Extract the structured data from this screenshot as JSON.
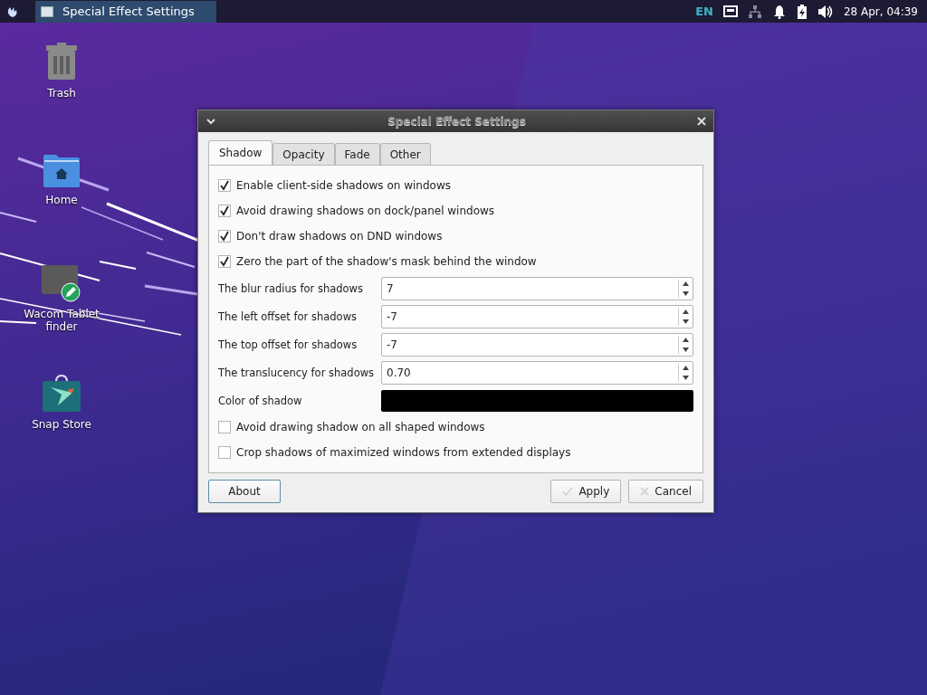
{
  "taskbar": {
    "window_button": "Special Effect Settings",
    "language": "EN",
    "clock": "28 Apr, 04:39"
  },
  "desktop_icons": [
    {
      "label": "Trash",
      "kind": "trash"
    },
    {
      "label": "Home",
      "kind": "home"
    },
    {
      "label": "Wacom Tablet finder",
      "kind": "wacom"
    },
    {
      "label": "Snap Store",
      "kind": "store"
    }
  ],
  "dialog": {
    "title": "Special Effect Settings",
    "tabs": [
      {
        "label": "Shadow",
        "selected": true
      },
      {
        "label": "Opacity",
        "selected": false
      },
      {
        "label": "Fade",
        "selected": false
      },
      {
        "label": "Other",
        "selected": false
      }
    ],
    "rows": [
      {
        "kind": "checkbox",
        "label": "Enable client-side shadows on windows",
        "checked": true
      },
      {
        "kind": "checkbox",
        "label": "Avoid drawing shadows on dock/panel windows",
        "checked": true
      },
      {
        "kind": "checkbox",
        "label": "Don't draw shadows on DND windows",
        "checked": true
      },
      {
        "kind": "checkbox",
        "label": "Zero the part of the shadow's mask behind the window",
        "checked": true
      },
      {
        "kind": "spin",
        "label": "The blur radius for shadows",
        "value": "7"
      },
      {
        "kind": "spin",
        "label": "The left offset for shadows",
        "value": "-7"
      },
      {
        "kind": "spin",
        "label": "The top offset for shadows",
        "value": "-7"
      },
      {
        "kind": "spin",
        "label": "The translucency for shadows",
        "value": "0.70"
      },
      {
        "kind": "color",
        "label": "Color of shadow",
        "color": "#000000"
      },
      {
        "kind": "checkbox",
        "label": "Avoid drawing shadow on all shaped windows",
        "checked": false
      },
      {
        "kind": "checkbox",
        "label": "Crop shadows of maximized windows from extended displays",
        "checked": false
      }
    ],
    "about_button": "About",
    "apply_button": "Apply",
    "cancel_button": "Cancel"
  }
}
